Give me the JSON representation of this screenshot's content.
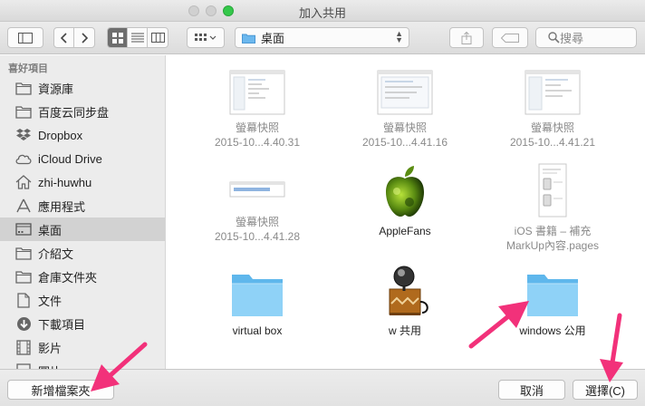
{
  "window": {
    "title": "加入共用"
  },
  "toolbar": {
    "location": "桌面",
    "search_placeholder": "搜尋"
  },
  "sidebar": {
    "section": "喜好項目",
    "items": [
      {
        "label": "資源庫",
        "icon": "folder-icon"
      },
      {
        "label": "百度云同步盘",
        "icon": "folder-icon"
      },
      {
        "label": "Dropbox",
        "icon": "dropbox-icon"
      },
      {
        "label": "iCloud Drive",
        "icon": "cloud-icon"
      },
      {
        "label": "zhi-huwhu",
        "icon": "home-icon"
      },
      {
        "label": "應用程式",
        "icon": "applications-icon"
      },
      {
        "label": "桌面",
        "icon": "desktop-icon",
        "selected": true
      },
      {
        "label": "介紹文",
        "icon": "folder-icon"
      },
      {
        "label": "倉庫文件夾",
        "icon": "folder-icon"
      },
      {
        "label": "文件",
        "icon": "document-icon"
      },
      {
        "label": "下載項目",
        "icon": "download-icon"
      },
      {
        "label": "影片",
        "icon": "film-icon"
      },
      {
        "label": "圖片",
        "icon": "picture-icon"
      }
    ]
  },
  "files": [
    {
      "line1": "螢幕快照",
      "line2": "2015-10...4.40.31",
      "kind": "screenshot",
      "enabled": false
    },
    {
      "line1": "螢幕快照",
      "line2": "2015-10...4.41.16",
      "kind": "screenshot",
      "enabled": false
    },
    {
      "line1": "螢幕快照",
      "line2": "2015-10...4.41.21",
      "kind": "screenshot",
      "enabled": false
    },
    {
      "line1": "螢幕快照",
      "line2": "2015-10...4.41.28",
      "kind": "screenshot-wide",
      "enabled": false
    },
    {
      "line1": "AppleFans",
      "line2": "",
      "kind": "apple-app",
      "enabled": true
    },
    {
      "line1": "iOS 書籍 – 補充",
      "line2": "MarkUp內容.pages",
      "kind": "document",
      "enabled": false
    },
    {
      "line1": "virtual box",
      "line2": "",
      "kind": "folder",
      "enabled": true
    },
    {
      "line1": "w 共用",
      "line2": "",
      "kind": "server-app",
      "enabled": true
    },
    {
      "line1": "windows  公用",
      "line2": "",
      "kind": "folder",
      "enabled": true
    }
  ],
  "bottom": {
    "new_folder": "新增檔案夾",
    "cancel": "取消",
    "choose": "選擇(C)"
  },
  "colors": {
    "accent_green": "#34c84a",
    "folder_blue": "#6cc4f4",
    "annotation_arrow": "#f2317a"
  }
}
